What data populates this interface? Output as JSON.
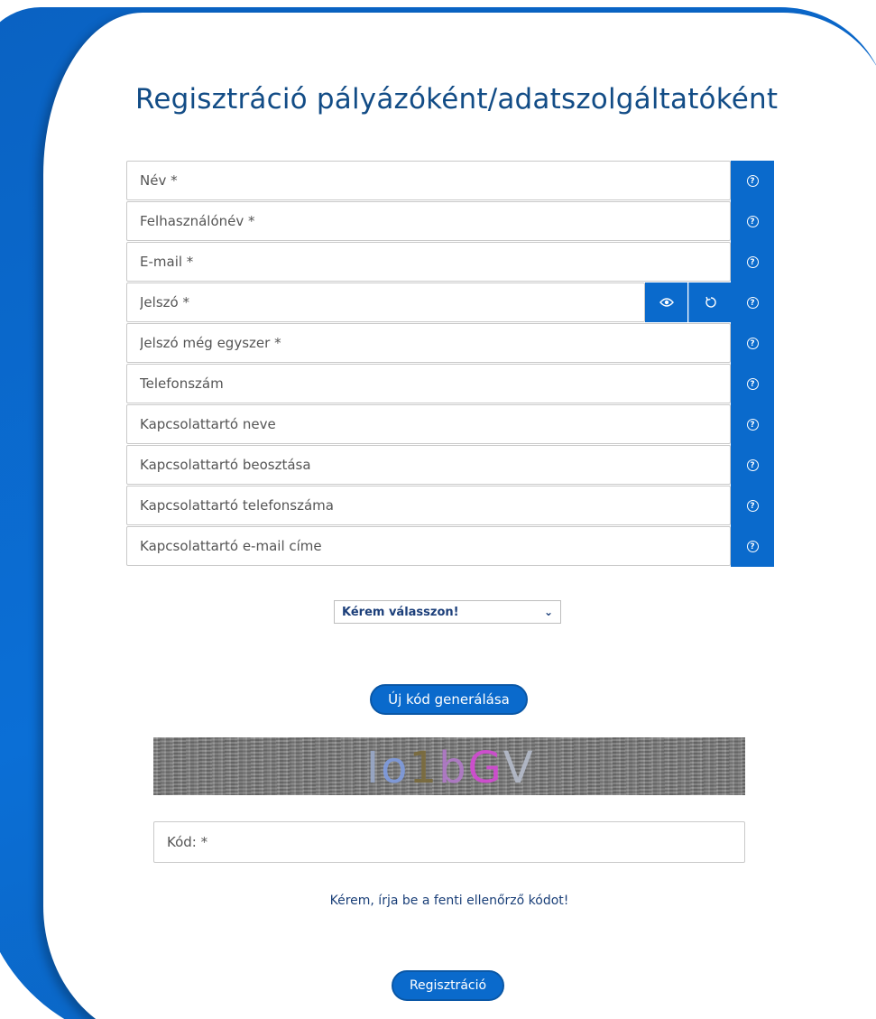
{
  "page": {
    "title": "Regisztráció pályázóként/adatszolgáltatóként"
  },
  "form": {
    "fields": [
      {
        "id": "nev",
        "placeholder": "Név *"
      },
      {
        "id": "felhasznalonev",
        "placeholder": "Felhasználónév *"
      },
      {
        "id": "email",
        "placeholder": "E-mail *"
      },
      {
        "id": "jelszo",
        "placeholder": "Jelszó *"
      },
      {
        "id": "jelszo2",
        "placeholder": "Jelszó még egyszer *"
      },
      {
        "id": "telefon",
        "placeholder": "Telefonszám"
      },
      {
        "id": "kapcs_nev",
        "placeholder": "Kapcsolattartó neve"
      },
      {
        "id": "kapcs_beosztas",
        "placeholder": "Kapcsolattartó beosztása"
      },
      {
        "id": "kapcs_telefon",
        "placeholder": "Kapcsolattartó telefonszáma"
      },
      {
        "id": "kapcs_email",
        "placeholder": "Kapcsolattartó e-mail címe"
      }
    ],
    "help_icon": "question-circle-icon",
    "password_buttons": {
      "show": "eye-icon",
      "regenerate": "refresh-icon"
    },
    "select": {
      "selected": "Kérem válasszon!"
    }
  },
  "captcha": {
    "generate_button": "Új kód generálása",
    "chars": [
      {
        "ch": "I",
        "color": "#9aa9c9"
      },
      {
        "ch": "o",
        "color": "#7f9ce0"
      },
      {
        "ch": "1",
        "color": "#7a6a3a"
      },
      {
        "ch": "b",
        "color": "#b27ac9"
      },
      {
        "ch": "G",
        "color": "#d44ad4"
      },
      {
        "ch": "V",
        "color": "#b5bccb"
      }
    ],
    "code_placeholder": "Kód: *",
    "hint": "Kérem, írja be a fenti ellenőrző kódot!"
  },
  "submit": {
    "label": "Regisztráció"
  },
  "colors": {
    "accent": "#0a6acc",
    "title": "#124c86",
    "frame": "#0b6fd6"
  }
}
